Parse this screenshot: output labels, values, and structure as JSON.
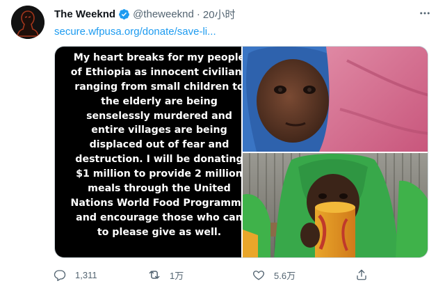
{
  "tweet": {
    "author": {
      "display_name": "The Weeknd",
      "handle": "@theweeknd",
      "verified": true
    },
    "separator": "·",
    "time": "20小时",
    "link_text": "secure.wfpusa.org/donate/save-li...",
    "media": {
      "notes_text_lines": [
        "My heart breaks for my people",
        "of Ethiopia as innocent civilians",
        "ranging from small children to",
        "the elderly are being",
        "senselessly murdered and",
        "entire villages are being",
        "displaced out of fear and",
        "destruction. I will be donating",
        "$1 million to provide 2 million",
        "meals through the United",
        "Nations World Food Programme",
        "and encourage those who can",
        "to please give as well."
      ]
    },
    "actions": {
      "reply": {
        "icon": "reply-icon",
        "count": "1,311"
      },
      "retweet": {
        "icon": "retweet-icon",
        "count": "1万"
      },
      "like": {
        "icon": "heart-icon",
        "count": "5.6万"
      },
      "share": {
        "icon": "share-icon",
        "count": ""
      }
    }
  },
  "colors": {
    "link": "#1d9bf0",
    "verified": "#1d9bf0",
    "secondary_text": "#536471",
    "notes_background": "#000000",
    "border": "#cfd9de"
  }
}
